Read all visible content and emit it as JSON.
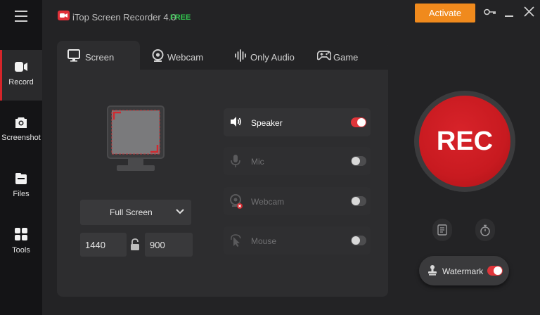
{
  "app": {
    "title": "iTop Screen Recorder 4.0",
    "badge": "FREE",
    "activate_label": "Activate"
  },
  "sidebar": {
    "items": [
      {
        "label": "Record",
        "icon": "record-icon",
        "active": true
      },
      {
        "label": "Screenshot",
        "icon": "camera-icon"
      },
      {
        "label": "Files",
        "icon": "files-icon"
      },
      {
        "label": "Tools",
        "icon": "tools-icon"
      }
    ]
  },
  "tabs": [
    {
      "label": "Screen",
      "icon": "monitor-icon",
      "active": true
    },
    {
      "label": "Webcam",
      "icon": "webcam-icon"
    },
    {
      "label": "Only Audio",
      "icon": "audio-wave-icon"
    },
    {
      "label": "Game",
      "icon": "gamepad-icon"
    }
  ],
  "screen": {
    "mode": "Full Screen",
    "width": "1440",
    "height": "900"
  },
  "options": [
    {
      "label": "Speaker",
      "icon": "speaker-icon",
      "on": true
    },
    {
      "label": "Mic",
      "icon": "mic-icon",
      "on": false
    },
    {
      "label": "Webcam",
      "icon": "webcam-off-icon",
      "on": false
    },
    {
      "label": "Mouse",
      "icon": "mouse-cursor-icon",
      "on": false
    }
  ],
  "rec_label": "REC",
  "watermark": {
    "label": "Watermark",
    "on": true
  },
  "colors": {
    "accent": "#d4252a",
    "activate": "#f08a1d",
    "free": "#32c24d"
  }
}
